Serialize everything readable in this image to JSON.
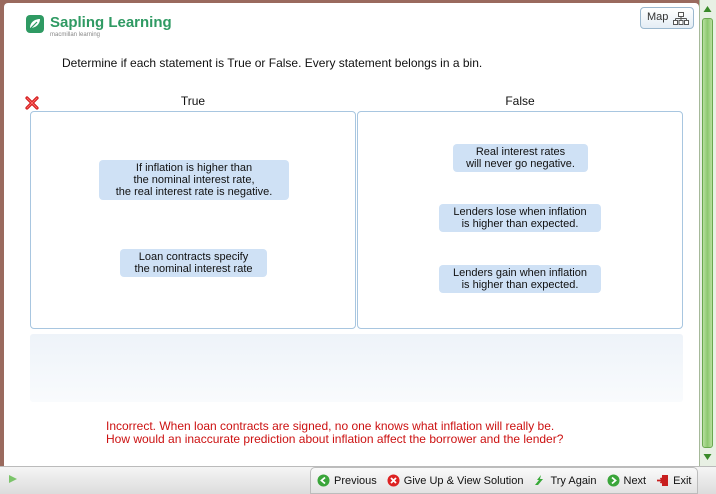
{
  "brand": {
    "name": "Sapling Learning",
    "sub": "macmillan learning",
    "color": "#2f9a63"
  },
  "map_button": {
    "label": "Map",
    "icon": "sitemap-icon"
  },
  "instruction": "Determine if each statement is True or False. Every statement belongs in a bin.",
  "status_icon": "red-x-icon",
  "bins": [
    {
      "label": "True",
      "cards": [
        "If inflation is higher than\nthe nominal interest rate,\nthe real interest rate is negative.",
        "Loan contracts specify\nthe nominal interest rate"
      ]
    },
    {
      "label": "False",
      "cards": [
        "Real interest rates\nwill never go negative.",
        "Lenders lose when inflation\nis higher than expected.",
        "Lenders gain when inflation\nis higher than expected."
      ]
    }
  ],
  "feedback": {
    "line1": "Incorrect. When loan contracts are signed, no one knows what inflation will really be.",
    "line2": "How would an inaccurate prediction about inflation affect the borrower and the lender?",
    "color": "#cc1111"
  },
  "nav": {
    "previous": "Previous",
    "give_up": "Give Up & View Solution",
    "try_again": "Try Again",
    "next": "Next",
    "exit": "Exit"
  }
}
